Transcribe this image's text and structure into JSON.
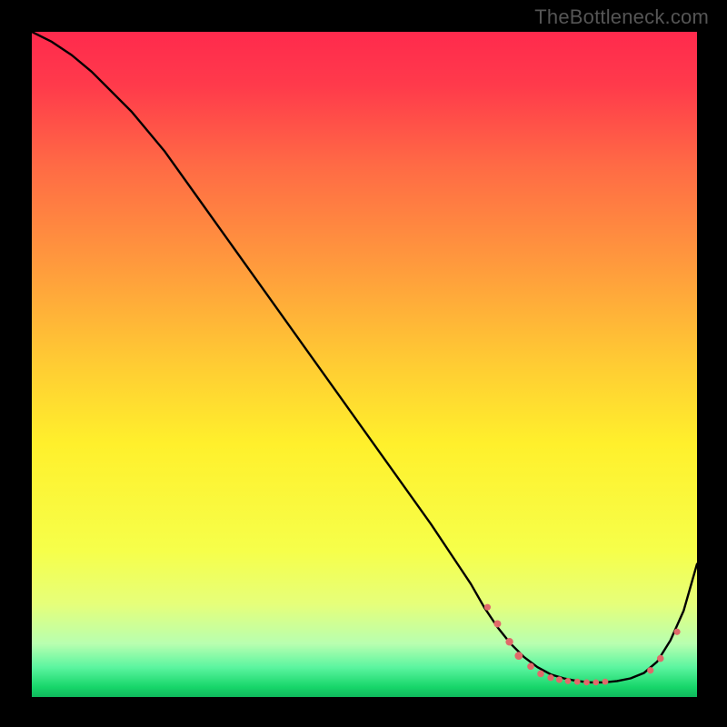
{
  "watermark": "TheBottleneck.com",
  "chart_data": {
    "type": "line",
    "title": "",
    "xlabel": "",
    "ylabel": "",
    "xlim": [
      0,
      100
    ],
    "ylim": [
      0,
      100
    ],
    "grid": false,
    "notes": "Axes carry no tick labels; values are read as percentages of plot area. Higher y (top of gradient, red) indicates worse; lower y (green band) indicates optimal.",
    "background_gradient": {
      "stops": [
        {
          "pos": 0.0,
          "color": "#ff2a4d"
        },
        {
          "pos": 0.08,
          "color": "#ff3a4b"
        },
        {
          "pos": 0.2,
          "color": "#ff6a45"
        },
        {
          "pos": 0.35,
          "color": "#ff9a3d"
        },
        {
          "pos": 0.5,
          "color": "#ffcc33"
        },
        {
          "pos": 0.62,
          "color": "#fff02c"
        },
        {
          "pos": 0.78,
          "color": "#f6ff4a"
        },
        {
          "pos": 0.86,
          "color": "#e6ff7a"
        },
        {
          "pos": 0.92,
          "color": "#b8ffb0"
        },
        {
          "pos": 0.955,
          "color": "#5cf5a0"
        },
        {
          "pos": 0.985,
          "color": "#17d66a"
        },
        {
          "pos": 1.0,
          "color": "#0fb85c"
        }
      ]
    },
    "series": [
      {
        "name": "curve",
        "color": "#000000",
        "x": [
          0,
          3,
          6,
          9,
          12,
          15,
          20,
          25,
          30,
          35,
          40,
          45,
          50,
          55,
          60,
          63,
          66,
          68,
          70,
          72,
          74,
          76,
          78,
          80,
          82,
          84,
          86,
          88,
          90,
          92,
          94,
          96,
          98,
          100
        ],
        "y": [
          100,
          98.5,
          96.5,
          94,
          91,
          88,
          82,
          75,
          68,
          61,
          54,
          47,
          40,
          33,
          26,
          21.5,
          17,
          13.5,
          10.5,
          8,
          6,
          4.5,
          3.4,
          2.8,
          2.4,
          2.2,
          2.2,
          2.4,
          2.8,
          3.6,
          5.3,
          8.5,
          13,
          20
        ]
      }
    ],
    "markers": [
      {
        "x": 68.5,
        "y": 13.5,
        "r": 3.6
      },
      {
        "x": 70.0,
        "y": 11.0,
        "r": 4.0
      },
      {
        "x": 71.8,
        "y": 8.3,
        "r": 4.2
      },
      {
        "x": 73.2,
        "y": 6.2,
        "r": 4.4
      },
      {
        "x": 75.0,
        "y": 4.6,
        "r": 3.8
      },
      {
        "x": 76.5,
        "y": 3.5,
        "r": 3.8
      },
      {
        "x": 78.0,
        "y": 2.9,
        "r": 3.6
      },
      {
        "x": 79.3,
        "y": 2.6,
        "r": 3.6
      },
      {
        "x": 80.6,
        "y": 2.4,
        "r": 3.4
      },
      {
        "x": 82.0,
        "y": 2.3,
        "r": 3.4
      },
      {
        "x": 83.4,
        "y": 2.2,
        "r": 3.4
      },
      {
        "x": 84.8,
        "y": 2.2,
        "r": 3.4
      },
      {
        "x": 86.2,
        "y": 2.3,
        "r": 3.4
      },
      {
        "x": 93.0,
        "y": 4.0,
        "r": 3.6
      },
      {
        "x": 94.5,
        "y": 5.8,
        "r": 3.8
      },
      {
        "x": 97.0,
        "y": 9.8,
        "r": 3.6
      }
    ],
    "marker_color": "#e06a6a"
  }
}
